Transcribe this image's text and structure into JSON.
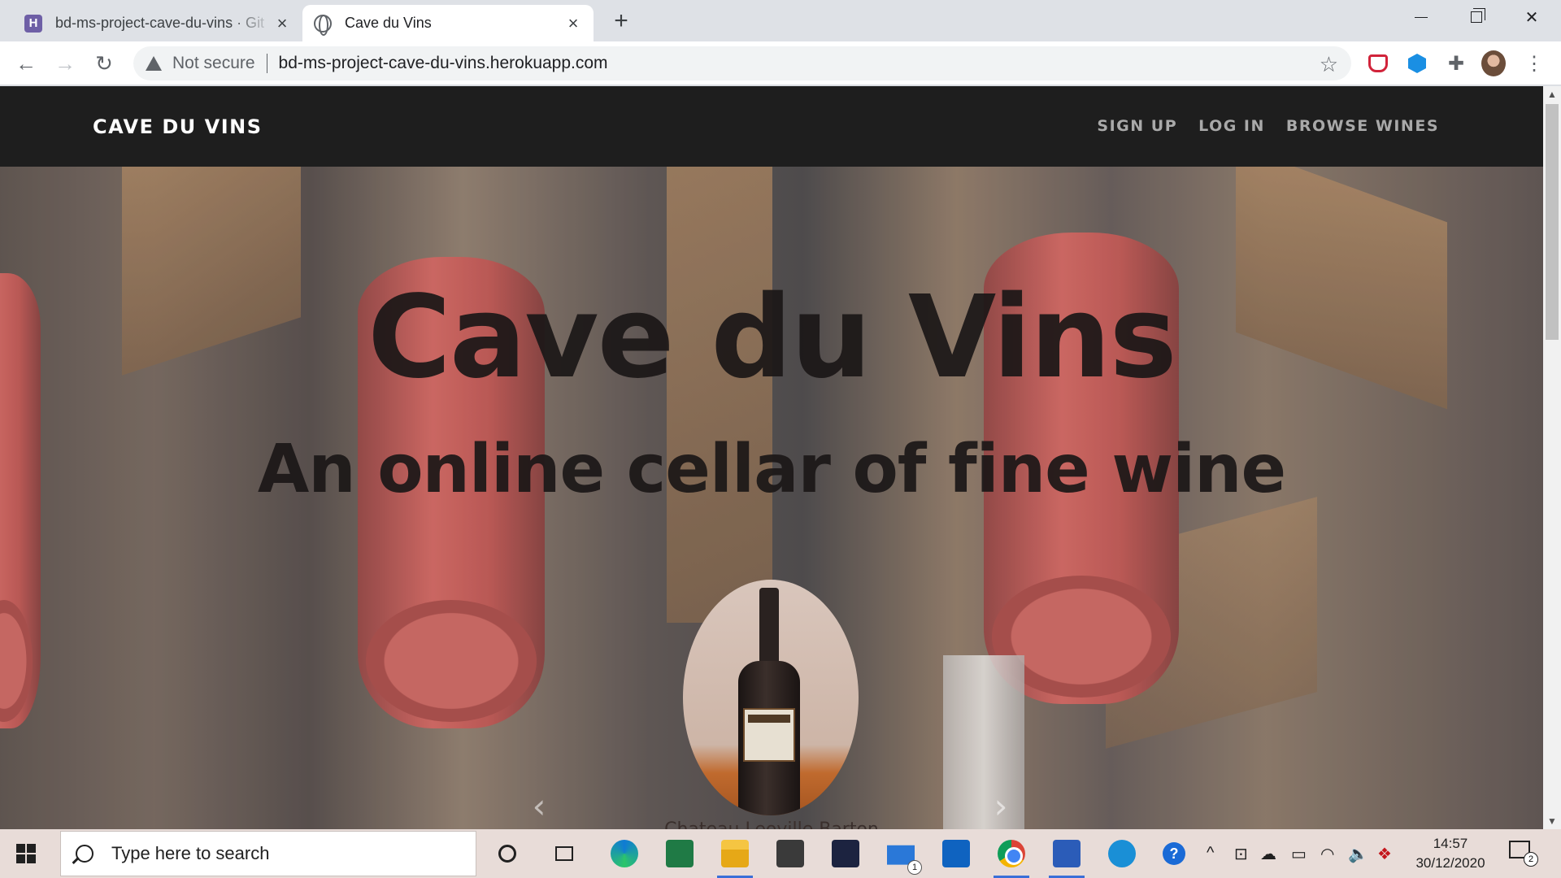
{
  "browser": {
    "tabs": [
      {
        "title": "bd-ms-project-cave-du-vins · Git",
        "favicon": "heroku-icon",
        "active": false
      },
      {
        "title": "Cave du Vins",
        "favicon": "globe-icon",
        "active": true
      }
    ],
    "new_tab_label": "+",
    "security_label": "Not secure",
    "url": "bd-ms-project-cave-du-vins.herokuapp.com"
  },
  "site": {
    "brand": "CAVE DU VINS",
    "nav": [
      {
        "label": "SIGN UP"
      },
      {
        "label": "LOG IN"
      },
      {
        "label": "BROWSE WINES"
      }
    ],
    "hero_title": "Cave du Vins",
    "hero_subtitle": "An online cellar of fine wine",
    "carousel_caption": "Chateau Leoville Barton",
    "carousel_prev": "‹",
    "carousel_next": "›"
  },
  "taskbar": {
    "search_placeholder": "Type here to search",
    "mail_badge": "1",
    "time": "14:57",
    "date": "30/12/2020",
    "notification_count": "2"
  },
  "colors": {
    "navbar_bg": "#1e1e1e",
    "nav_link": "#a9a9a9",
    "hero_text": "#1b1717",
    "cork_red": "#b44b47"
  }
}
